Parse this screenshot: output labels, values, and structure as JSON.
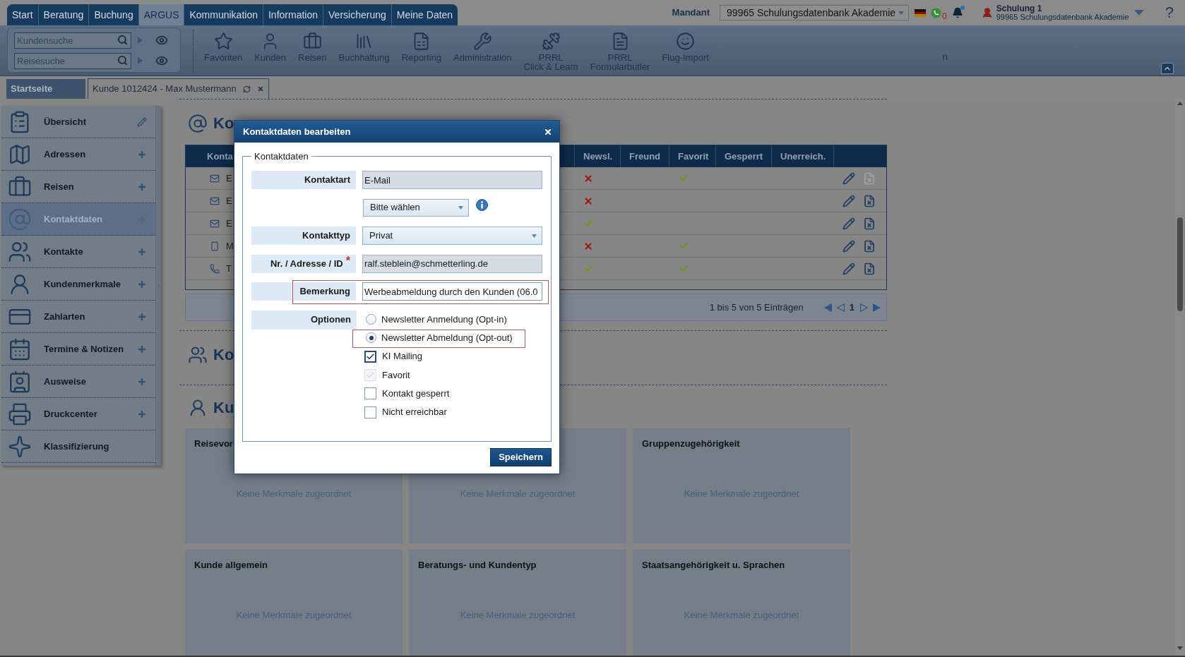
{
  "top_nav": {
    "tabs": [
      {
        "label": "Start",
        "selected": false
      },
      {
        "label": "Beratung",
        "selected": false
      },
      {
        "label": "Buchung",
        "selected": false
      },
      {
        "label": "ARGUS",
        "selected": true
      },
      {
        "label": "Kommunikation",
        "selected": false
      },
      {
        "label": "Information",
        "selected": false
      },
      {
        "label": "Versicherung",
        "selected": false
      },
      {
        "label": "Meine Daten",
        "selected": false
      }
    ]
  },
  "header": {
    "mandant_label": "Mandant",
    "mandant_value": "99965 Schulungsdatenbank Akademie",
    "message_count": "0",
    "user_name": "Schulung 1",
    "user_org": "99965 Schulungsdatenbank Akademie",
    "help": "?"
  },
  "quick_search": [
    {
      "placeholder": "Kundensuche"
    },
    {
      "placeholder": "Reisesuche"
    }
  ],
  "toolbar": {
    "items": [
      {
        "label": "Favoriten"
      },
      {
        "label": "Kunden"
      },
      {
        "label": "Reisen"
      },
      {
        "label": "Buchhaltung"
      },
      {
        "label": "Reporting"
      },
      {
        "label": "Administration"
      },
      {
        "label": "PRRL\nClick & Learn"
      },
      {
        "label": "PRRL\nFormularbutler"
      },
      {
        "label": "Flug-Import"
      }
    ],
    "note": "n"
  },
  "doc_tabs": [
    {
      "label": "Startseite",
      "selected": false,
      "closable": false
    },
    {
      "label": "Kunde 1012424 - Max Mustermann",
      "selected": true,
      "closable": true
    }
  ],
  "sidebar": {
    "items": [
      {
        "label": "Übersicht",
        "selected": false,
        "kind": "edit"
      },
      {
        "label": "Adressen",
        "selected": false,
        "kind": "add"
      },
      {
        "label": "Reisen",
        "selected": false,
        "kind": "add"
      },
      {
        "label": "Kontaktdaten",
        "selected": true,
        "kind": "add"
      },
      {
        "label": "Kontakte",
        "selected": false,
        "kind": "add"
      },
      {
        "label": "Kundenmerkmale",
        "selected": false,
        "kind": "add"
      },
      {
        "label": "Zahlarten",
        "selected": false,
        "kind": "add"
      },
      {
        "label": "Termine & Notizen",
        "selected": false,
        "kind": "add"
      },
      {
        "label": "Ausweise",
        "selected": false,
        "kind": "add"
      },
      {
        "label": "Druckcenter",
        "selected": false,
        "kind": "add"
      },
      {
        "label": "Klassifizierung",
        "selected": false,
        "kind": "plain"
      }
    ]
  },
  "contact_data_section": {
    "heading": "Ko",
    "table": {
      "columns": [
        "Konta",
        "Newsl.",
        "Freund",
        "Favorit",
        "Gesperrt",
        "Unerreich."
      ],
      "rows": [
        {
          "kind": "email",
          "column_1": "E",
          "newsletter": false,
          "favorite": true,
          "delete_disabled": true
        },
        {
          "kind": "email",
          "column_1": "E",
          "newsletter": false,
          "favorite": false,
          "delete_disabled": false
        },
        {
          "kind": "email",
          "column_1": "E",
          "newsletter": true,
          "favorite": false,
          "delete_disabled": false
        },
        {
          "kind": "mobile",
          "column_1": "M",
          "newsletter": false,
          "favorite": true,
          "delete_disabled": false
        },
        {
          "kind": "phone",
          "column_1": "T",
          "newsletter": true,
          "favorite": true,
          "delete_disabled": false
        }
      ]
    },
    "pager": {
      "summary": "1 bis 5 von 5 Einträgen",
      "page": "1"
    }
  },
  "contacts_section": {
    "heading": "Ko"
  },
  "features_section": {
    "heading": "Ku",
    "cards": [
      {
        "title": "Reisevor",
        "empty_text": "Keine Merkmale zugeordnet"
      },
      {
        "empty_text": "Keine Merkmale zugeordnet"
      },
      {
        "title": "Gruppenzugehörigkeit",
        "empty_text": "Keine Merkmale zugeordnet"
      },
      {
        "title": "Kunde allgemein",
        "empty_text": "Keine Merkmale zugeordnet"
      },
      {
        "title": "Beratungs- und Kundentyp",
        "empty_text": "Keine Merkmale zugeordnet"
      },
      {
        "title": "Staatsangehörigkeit u. Sprachen",
        "empty_text": "Keine Merkmale zugeordnet"
      }
    ]
  },
  "dialog": {
    "title": "Kontaktdaten bearbeiten",
    "legend": "Kontaktdaten",
    "fields": [
      {
        "kind": "readonly",
        "label": "Kontaktart",
        "value": "E-Mail",
        "highlighted": false
      },
      {
        "kind": "select",
        "value": "Bitte wählen",
        "info": true,
        "highlighted": false
      },
      {
        "kind": "select",
        "label": "Kontakttyp",
        "value": "Privat",
        "highlighted": false
      },
      {
        "kind": "readonly",
        "label": "Nr. / Adresse / ID",
        "required_mark": "*",
        "value": "ralf.steblein@schmetterling.de",
        "highlighted": false
      },
      {
        "kind": "text",
        "label": "Bemerkung",
        "value": "Werbeabmeldung durch den Kunden (06.0",
        "highlighted": true
      }
    ],
    "options": {
      "label": "Optionen",
      "radios": [
        {
          "label": "Newsletter Anmeldung (Opt-in)",
          "selected": false,
          "highlighted": false
        },
        {
          "label": "Newsletter Abmeldung (Opt-out)",
          "selected": true,
          "highlighted": true
        }
      ],
      "checkboxes": [
        {
          "label": "KI Mailing",
          "checked": true,
          "disabled": false
        },
        {
          "label": "Favorit",
          "checked": true,
          "disabled": true
        },
        {
          "label": "Kontakt gesperrt",
          "checked": false,
          "disabled": false
        },
        {
          "label": "Nicht erreichbar",
          "checked": false,
          "disabled": false
        }
      ]
    },
    "save_button": "Speichern"
  }
}
